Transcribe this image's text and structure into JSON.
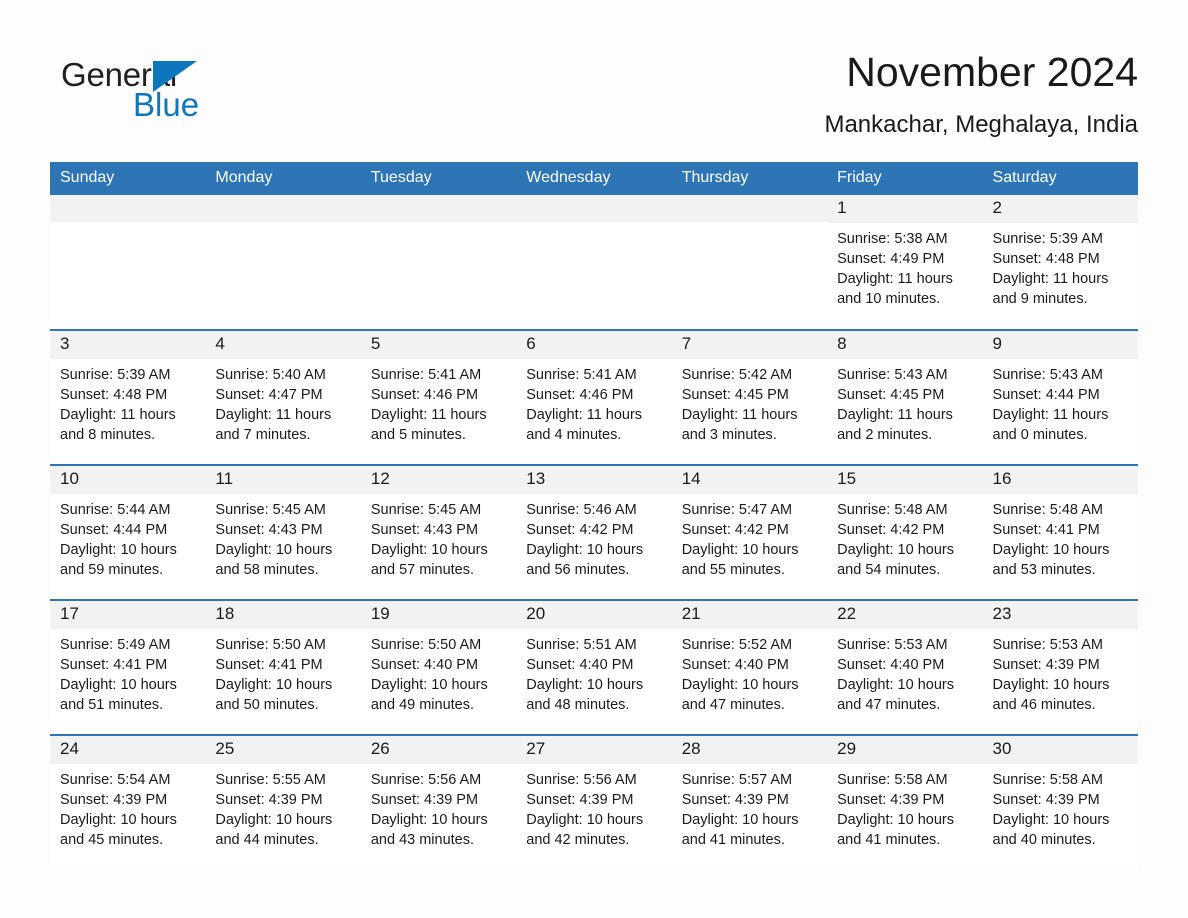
{
  "brand": {
    "name_part1": "General",
    "name_part2": "Blue",
    "accent_color": "#0e76bc",
    "logo_icon": "triangle-logo-icon"
  },
  "header": {
    "title": "November 2024",
    "subtitle": "Mankachar, Meghalaya, India"
  },
  "calendar": {
    "header_bg": "#2e75b6",
    "daynum_bg": "#f2f2f2",
    "weekday_labels": [
      "Sunday",
      "Monday",
      "Tuesday",
      "Wednesday",
      "Thursday",
      "Friday",
      "Saturday"
    ],
    "weeks": [
      [
        {
          "day": "",
          "blank": true
        },
        {
          "day": "",
          "blank": true
        },
        {
          "day": "",
          "blank": true
        },
        {
          "day": "",
          "blank": true
        },
        {
          "day": "",
          "blank": true
        },
        {
          "day": "1",
          "sunrise": "Sunrise: 5:38 AM",
          "sunset": "Sunset: 4:49 PM",
          "daylight_line1": "Daylight: 11 hours",
          "daylight_line2": "and 10 minutes."
        },
        {
          "day": "2",
          "sunrise": "Sunrise: 5:39 AM",
          "sunset": "Sunset: 4:48 PM",
          "daylight_line1": "Daylight: 11 hours",
          "daylight_line2": "and 9 minutes."
        }
      ],
      [
        {
          "day": "3",
          "sunrise": "Sunrise: 5:39 AM",
          "sunset": "Sunset: 4:48 PM",
          "daylight_line1": "Daylight: 11 hours",
          "daylight_line2": "and 8 minutes."
        },
        {
          "day": "4",
          "sunrise": "Sunrise: 5:40 AM",
          "sunset": "Sunset: 4:47 PM",
          "daylight_line1": "Daylight: 11 hours",
          "daylight_line2": "and 7 minutes."
        },
        {
          "day": "5",
          "sunrise": "Sunrise: 5:41 AM",
          "sunset": "Sunset: 4:46 PM",
          "daylight_line1": "Daylight: 11 hours",
          "daylight_line2": "and 5 minutes."
        },
        {
          "day": "6",
          "sunrise": "Sunrise: 5:41 AM",
          "sunset": "Sunset: 4:46 PM",
          "daylight_line1": "Daylight: 11 hours",
          "daylight_line2": "and 4 minutes."
        },
        {
          "day": "7",
          "sunrise": "Sunrise: 5:42 AM",
          "sunset": "Sunset: 4:45 PM",
          "daylight_line1": "Daylight: 11 hours",
          "daylight_line2": "and 3 minutes."
        },
        {
          "day": "8",
          "sunrise": "Sunrise: 5:43 AM",
          "sunset": "Sunset: 4:45 PM",
          "daylight_line1": "Daylight: 11 hours",
          "daylight_line2": "and 2 minutes."
        },
        {
          "day": "9",
          "sunrise": "Sunrise: 5:43 AM",
          "sunset": "Sunset: 4:44 PM",
          "daylight_line1": "Daylight: 11 hours",
          "daylight_line2": "and 0 minutes."
        }
      ],
      [
        {
          "day": "10",
          "sunrise": "Sunrise: 5:44 AM",
          "sunset": "Sunset: 4:44 PM",
          "daylight_line1": "Daylight: 10 hours",
          "daylight_line2": "and 59 minutes."
        },
        {
          "day": "11",
          "sunrise": "Sunrise: 5:45 AM",
          "sunset": "Sunset: 4:43 PM",
          "daylight_line1": "Daylight: 10 hours",
          "daylight_line2": "and 58 minutes."
        },
        {
          "day": "12",
          "sunrise": "Sunrise: 5:45 AM",
          "sunset": "Sunset: 4:43 PM",
          "daylight_line1": "Daylight: 10 hours",
          "daylight_line2": "and 57 minutes."
        },
        {
          "day": "13",
          "sunrise": "Sunrise: 5:46 AM",
          "sunset": "Sunset: 4:42 PM",
          "daylight_line1": "Daylight: 10 hours",
          "daylight_line2": "and 56 minutes."
        },
        {
          "day": "14",
          "sunrise": "Sunrise: 5:47 AM",
          "sunset": "Sunset: 4:42 PM",
          "daylight_line1": "Daylight: 10 hours",
          "daylight_line2": "and 55 minutes."
        },
        {
          "day": "15",
          "sunrise": "Sunrise: 5:48 AM",
          "sunset": "Sunset: 4:42 PM",
          "daylight_line1": "Daylight: 10 hours",
          "daylight_line2": "and 54 minutes."
        },
        {
          "day": "16",
          "sunrise": "Sunrise: 5:48 AM",
          "sunset": "Sunset: 4:41 PM",
          "daylight_line1": "Daylight: 10 hours",
          "daylight_line2": "and 53 minutes."
        }
      ],
      [
        {
          "day": "17",
          "sunrise": "Sunrise: 5:49 AM",
          "sunset": "Sunset: 4:41 PM",
          "daylight_line1": "Daylight: 10 hours",
          "daylight_line2": "and 51 minutes."
        },
        {
          "day": "18",
          "sunrise": "Sunrise: 5:50 AM",
          "sunset": "Sunset: 4:41 PM",
          "daylight_line1": "Daylight: 10 hours",
          "daylight_line2": "and 50 minutes."
        },
        {
          "day": "19",
          "sunrise": "Sunrise: 5:50 AM",
          "sunset": "Sunset: 4:40 PM",
          "daylight_line1": "Daylight: 10 hours",
          "daylight_line2": "and 49 minutes."
        },
        {
          "day": "20",
          "sunrise": "Sunrise: 5:51 AM",
          "sunset": "Sunset: 4:40 PM",
          "daylight_line1": "Daylight: 10 hours",
          "daylight_line2": "and 48 minutes."
        },
        {
          "day": "21",
          "sunrise": "Sunrise: 5:52 AM",
          "sunset": "Sunset: 4:40 PM",
          "daylight_line1": "Daylight: 10 hours",
          "daylight_line2": "and 47 minutes."
        },
        {
          "day": "22",
          "sunrise": "Sunrise: 5:53 AM",
          "sunset": "Sunset: 4:40 PM",
          "daylight_line1": "Daylight: 10 hours",
          "daylight_line2": "and 47 minutes."
        },
        {
          "day": "23",
          "sunrise": "Sunrise: 5:53 AM",
          "sunset": "Sunset: 4:39 PM",
          "daylight_line1": "Daylight: 10 hours",
          "daylight_line2": "and 46 minutes."
        }
      ],
      [
        {
          "day": "24",
          "sunrise": "Sunrise: 5:54 AM",
          "sunset": "Sunset: 4:39 PM",
          "daylight_line1": "Daylight: 10 hours",
          "daylight_line2": "and 45 minutes."
        },
        {
          "day": "25",
          "sunrise": "Sunrise: 5:55 AM",
          "sunset": "Sunset: 4:39 PM",
          "daylight_line1": "Daylight: 10 hours",
          "daylight_line2": "and 44 minutes."
        },
        {
          "day": "26",
          "sunrise": "Sunrise: 5:56 AM",
          "sunset": "Sunset: 4:39 PM",
          "daylight_line1": "Daylight: 10 hours",
          "daylight_line2": "and 43 minutes."
        },
        {
          "day": "27",
          "sunrise": "Sunrise: 5:56 AM",
          "sunset": "Sunset: 4:39 PM",
          "daylight_line1": "Daylight: 10 hours",
          "daylight_line2": "and 42 minutes."
        },
        {
          "day": "28",
          "sunrise": "Sunrise: 5:57 AM",
          "sunset": "Sunset: 4:39 PM",
          "daylight_line1": "Daylight: 10 hours",
          "daylight_line2": "and 41 minutes."
        },
        {
          "day": "29",
          "sunrise": "Sunrise: 5:58 AM",
          "sunset": "Sunset: 4:39 PM",
          "daylight_line1": "Daylight: 10 hours",
          "daylight_line2": "and 41 minutes."
        },
        {
          "day": "30",
          "sunrise": "Sunrise: 5:58 AM",
          "sunset": "Sunset: 4:39 PM",
          "daylight_line1": "Daylight: 10 hours",
          "daylight_line2": "and 40 minutes."
        }
      ]
    ]
  }
}
